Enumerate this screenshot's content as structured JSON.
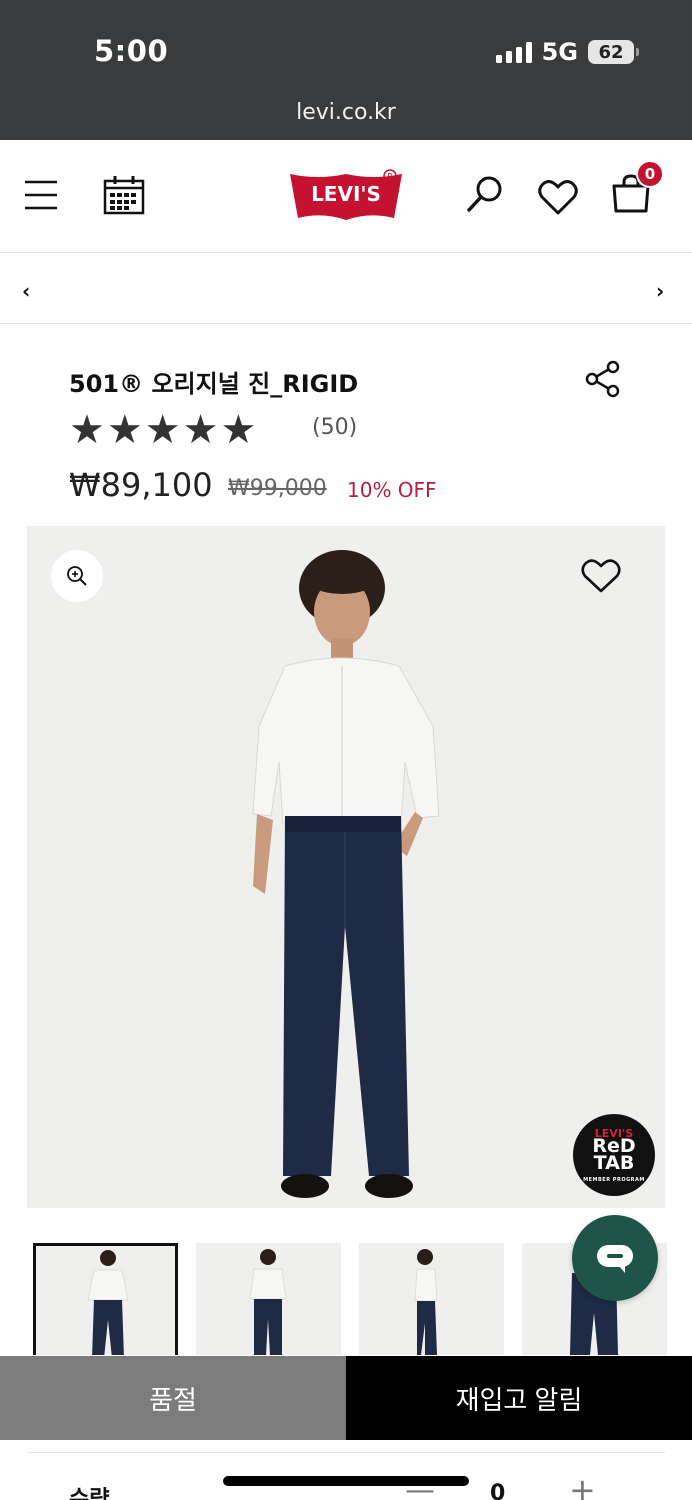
{
  "status": {
    "time": "5:00",
    "network": "5G",
    "battery": "62"
  },
  "browser": {
    "url": "levi.co.kr"
  },
  "header": {
    "logo_text": "LEVI'S",
    "cart_count": "0"
  },
  "product": {
    "title": "501® 오리지널 진_RIGID",
    "rating": 5,
    "review_count": "(50)",
    "price": "₩89,100",
    "original_price": "₩99,000",
    "discount": "10% OFF"
  },
  "badge": {
    "line1": "LEVI'S",
    "line2": "ReD",
    "line3": "TAB",
    "line4": "MEMBER PROGRAM"
  },
  "buttons": {
    "sold_out": "품절",
    "restock_alert": "재입고 알림"
  },
  "quantity": {
    "label": "수량",
    "value": "0",
    "minus": "—",
    "plus": "+"
  },
  "colors": {
    "brand_red": "#c41230",
    "chat_green": "#1e5548",
    "discount_red": "#b2223a"
  }
}
